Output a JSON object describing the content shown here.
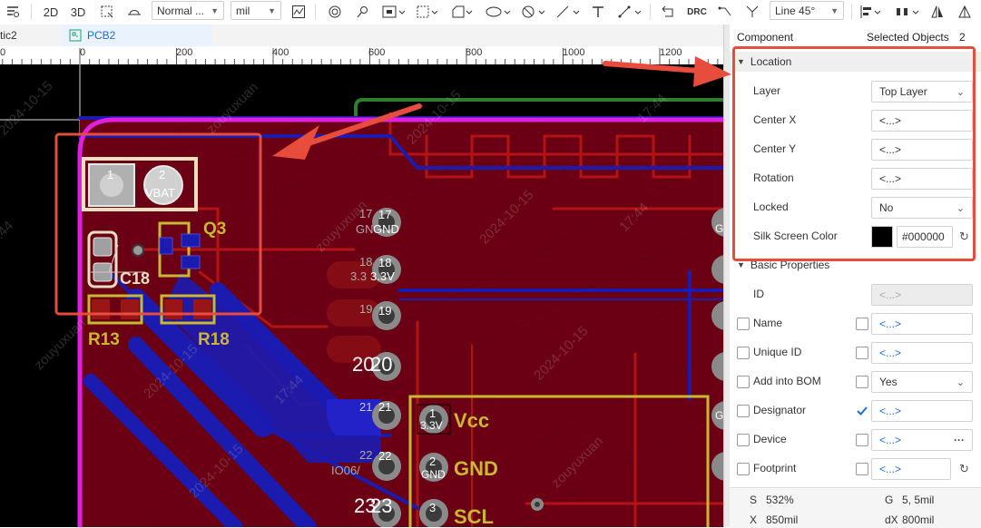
{
  "toolbar": {
    "btn_2d": "2D",
    "btn_3d": "3D",
    "view_mode": "Normal ...",
    "unit": "mil",
    "drc_label": "DRC",
    "route_mode": "Line 45°"
  },
  "tabs": [
    {
      "label": "tic2"
    },
    {
      "label": "PCB2"
    }
  ],
  "ruler": {
    "ticks": [
      "0",
      "0",
      "200",
      "400",
      "600",
      "800",
      "1000",
      "1200"
    ]
  },
  "canvas": {
    "labels": {
      "q3": "Q3",
      "c18": "C18",
      "r13": "R13",
      "r18": "R18",
      "vcc": "Vcc",
      "gnd": "GND",
      "scl": "SCL",
      "pad1": "1",
      "pad2": "2",
      "vbat": "VBAT",
      "p17": "17",
      "p17b": "17",
      "gn": "GN",
      "gnd17": "GND",
      "p18": "18",
      "p18b": "18",
      "v33a": "3.3",
      "v33b": "3.3V",
      "p19": "19",
      "p19b": "19",
      "p20": "20",
      "p20b": "20",
      "p21": "21",
      "p21b": "21",
      "p22": "22",
      "p22b": "22",
      "io06": "IO06/",
      "p23": "23",
      "p23b": "23",
      "h1": "1",
      "h1v": "3.3V",
      "h2": "2",
      "h2g": "GND",
      "h3": "3",
      "e1": "G",
      "e2": "G"
    },
    "watermarks": [
      "zouyuxuan",
      "2024-10-15",
      "17:44"
    ]
  },
  "panel": {
    "header_left": "Component",
    "header_right": "Selected Objects",
    "header_count": "2",
    "location": {
      "title": "Location",
      "rows": [
        {
          "label": "Layer",
          "value": "Top Layer",
          "kind": "select"
        },
        {
          "label": "Center X",
          "value": "<...>",
          "kind": "input"
        },
        {
          "label": "Center Y",
          "value": "<...>",
          "kind": "input"
        },
        {
          "label": "Rotation",
          "value": "<...>",
          "kind": "input"
        },
        {
          "label": "Locked",
          "value": "No",
          "kind": "select"
        },
        {
          "label": "Silk Screen Color",
          "value": "#000000",
          "kind": "color"
        }
      ]
    },
    "basic": {
      "title": "Basic Properties",
      "rows": [
        {
          "label": "ID",
          "value": "<...>",
          "kind": "disabled"
        },
        {
          "label": "Name",
          "value": "<...>",
          "kind": "input"
        },
        {
          "label": "Unique ID",
          "value": "<...>",
          "kind": "input"
        },
        {
          "label": "Add into BOM",
          "value": "Yes",
          "kind": "select"
        },
        {
          "label": "Designator",
          "value": "<...>",
          "kind": "input"
        },
        {
          "label": "Device",
          "value": "<...>",
          "kind": "input"
        },
        {
          "label": "Footprint",
          "value": "<...>",
          "kind": "input"
        }
      ]
    },
    "status": {
      "s_label": "S",
      "s_value": "532%",
      "g_label": "G",
      "g_value": "5, 5mil",
      "x_label": "X",
      "x_value": "850mil",
      "dx_label": "dX",
      "dx_value": "800mil"
    }
  },
  "colors": {
    "board_fill": "#6b0014",
    "top_copper": "#b21414",
    "bottom_copper": "#1b1bb0",
    "outline": "#e020e0",
    "silk": "#c8b832",
    "highlight": "#e84c3d",
    "accent": "#1f6fd2"
  }
}
